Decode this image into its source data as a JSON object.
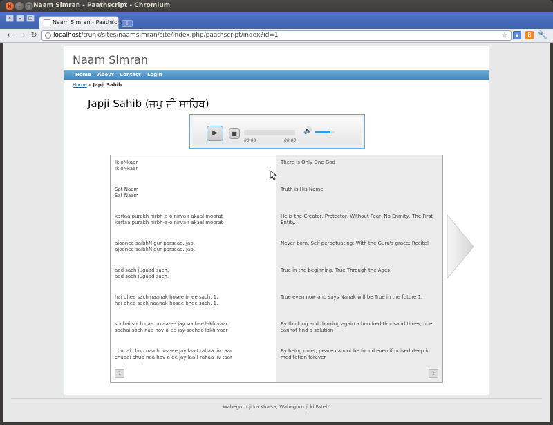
{
  "window": {
    "title": "Naam Simran - Paathscript - Chromium"
  },
  "tabs": [
    {
      "label": "Naam Simran - Paathscript",
      "close": "×"
    }
  ],
  "toolbar": {
    "url_host": "localhost",
    "url_path": "/trunk/sites/naamsimran/site/index.php/paathscript/index?id=1"
  },
  "site": {
    "title": "Naam Simran",
    "menu": [
      "Home",
      "About",
      "Contact",
      "Login"
    ]
  },
  "breadcrumb": {
    "home": "Home",
    "sep": " » ",
    "current": "Japji Sahib"
  },
  "page_title": "Japji Sahib (ਜਪੁ ਜੀ ਸਾਹਿਬ)",
  "player": {
    "current_time": "00:00",
    "duration": "00:00",
    "volume_level": 0.8
  },
  "verses": [
    {
      "gurmukhi": "Ik oNkaar",
      "translit": "Ik oNkaar",
      "translation": "There is Only One God"
    },
    {
      "gurmukhi": "Sat Naam",
      "translit": "Sat Naam",
      "translation": "Truth is His Name"
    },
    {
      "gurmukhi": "kartaa purakh nirbh-a-o nirvair akaal moorat",
      "translit": "kartaa purakh nirbh-a-o nirvair akaal moorat",
      "translation": "He is the Creator, Protector, Without Fear, No Enmity, The First Entity."
    },
    {
      "gurmukhi": "ajoonee saibhN gur parsaad. jap.",
      "translit": "ajoonee saibhN gur parsaad. jap.",
      "translation": "Never born, Self-perpetuating; With the Guru's grace: Recite!"
    },
    {
      "gurmukhi": "aad sach jugaad sach.",
      "translit": "aad sach jugaad sach.",
      "translation": "True in the beginning, True Through the Ages,"
    },
    {
      "gurmukhi": "hai bhee sach naanak hosee bhee sach. 1.",
      "translit": "hai bhee sach naanak hosee bhee sach. 1.",
      "translation": "True even now and says Nanak will be True in the future 1."
    },
    {
      "gurmukhi": "sochai soch naa hov-a-ee jay sochee lakh vaar",
      "translit": "sochai soch naa hov-a-ee jay sochee lakh vaar",
      "translation": "By thinking and thinking again a hundred thousand times, one cannot find a solution"
    },
    {
      "gurmukhi": "chupai chup naa hov-a-ee jay laa-I rahaa liv taar",
      "translit": "chupai chup naa hov-a-ee jay laa-I rahaa liv taar",
      "translation": "By being quiet, peace cannot be found even if poised deep in meditation forever"
    }
  ],
  "pager": {
    "left": "1",
    "right": "2"
  },
  "footer": "Waheguru ji ka Khalsa, Waheguru ji ki Fateh."
}
